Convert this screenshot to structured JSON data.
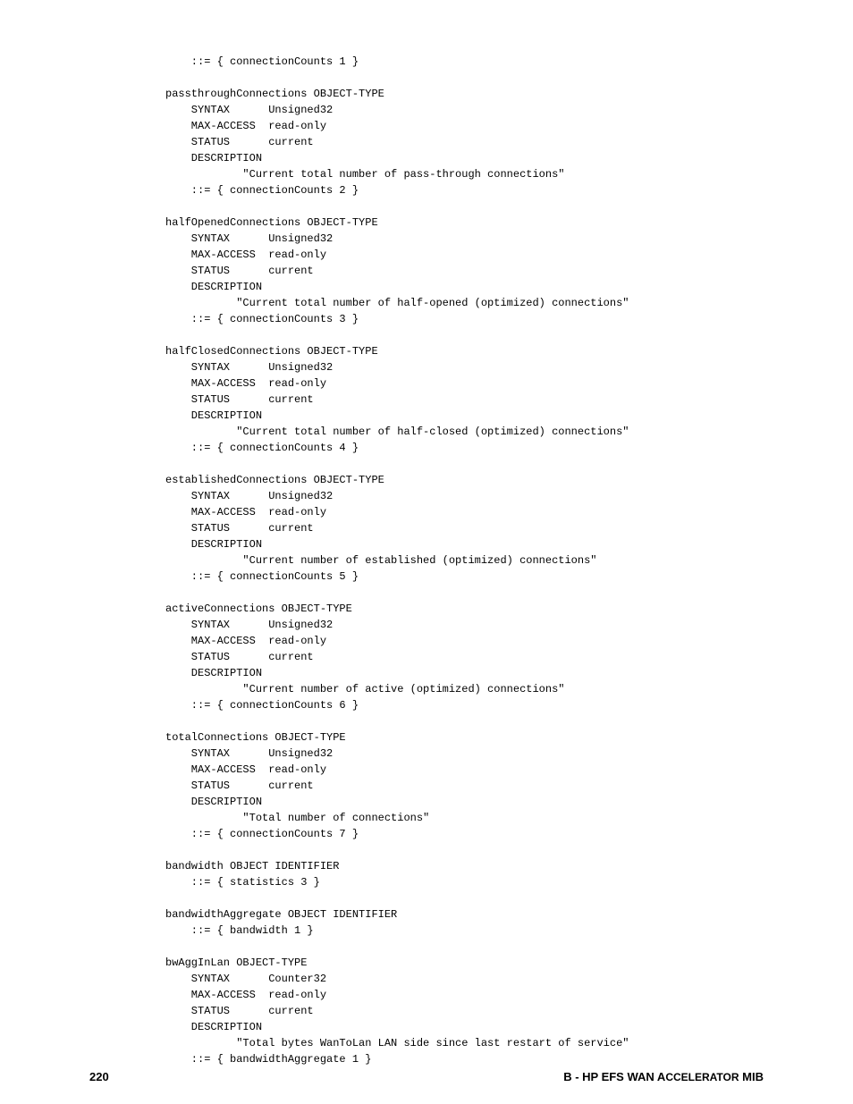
{
  "indent": "    ",
  "blocks": [
    {
      "name": "intro",
      "lines": [
        "    ::= { connectionCounts 1 }",
        ""
      ]
    },
    {
      "name": "passthroughConnections",
      "lines": [
        "passthroughConnections OBJECT-TYPE",
        "    SYNTAX      Unsigned32",
        "    MAX-ACCESS  read-only",
        "    STATUS      current",
        "    DESCRIPTION",
        "            \"Current total number of pass-through connections\"",
        "    ::= { connectionCounts 2 }",
        ""
      ]
    },
    {
      "name": "halfOpenedConnections",
      "lines": [
        "halfOpenedConnections OBJECT-TYPE",
        "    SYNTAX      Unsigned32",
        "    MAX-ACCESS  read-only",
        "    STATUS      current",
        "    DESCRIPTION",
        "           \"Current total number of half-opened (optimized) connections\"",
        "    ::= { connectionCounts 3 }",
        ""
      ]
    },
    {
      "name": "halfClosedConnections",
      "lines": [
        "halfClosedConnections OBJECT-TYPE",
        "    SYNTAX      Unsigned32",
        "    MAX-ACCESS  read-only",
        "    STATUS      current",
        "    DESCRIPTION",
        "           \"Current total number of half-closed (optimized) connections\"",
        "    ::= { connectionCounts 4 }",
        ""
      ]
    },
    {
      "name": "establishedConnections",
      "lines": [
        "establishedConnections OBJECT-TYPE",
        "    SYNTAX      Unsigned32",
        "    MAX-ACCESS  read-only",
        "    STATUS      current",
        "    DESCRIPTION",
        "            \"Current number of established (optimized) connections\"",
        "    ::= { connectionCounts 5 }",
        ""
      ]
    },
    {
      "name": "activeConnections",
      "lines": [
        "activeConnections OBJECT-TYPE",
        "    SYNTAX      Unsigned32",
        "    MAX-ACCESS  read-only",
        "    STATUS      current",
        "    DESCRIPTION",
        "            \"Current number of active (optimized) connections\"",
        "    ::= { connectionCounts 6 }",
        ""
      ]
    },
    {
      "name": "totalConnections",
      "lines": [
        "totalConnections OBJECT-TYPE",
        "    SYNTAX      Unsigned32",
        "    MAX-ACCESS  read-only",
        "    STATUS      current",
        "    DESCRIPTION",
        "            \"Total number of connections\"",
        "    ::= { connectionCounts 7 }",
        ""
      ]
    },
    {
      "name": "bandwidth",
      "lines": [
        "bandwidth OBJECT IDENTIFIER",
        "    ::= { statistics 3 }",
        ""
      ]
    },
    {
      "name": "bandwidthAggregate",
      "lines": [
        "bandwidthAggregate OBJECT IDENTIFIER",
        "    ::= { bandwidth 1 }",
        ""
      ]
    },
    {
      "name": "bwAggInLan",
      "lines": [
        "bwAggInLan OBJECT-TYPE",
        "    SYNTAX      Counter32",
        "    MAX-ACCESS  read-only",
        "    STATUS      current",
        "    DESCRIPTION",
        "           \"Total bytes WanToLan LAN side since last restart of service\"",
        "    ::= { bandwidthAggregate 1 }"
      ]
    }
  ],
  "footer": {
    "page_number": "220",
    "title_prefix": "B - HP EFS WAN A",
    "title_smallcaps": "CCELERATOR",
    "title_suffix": " MIB"
  }
}
